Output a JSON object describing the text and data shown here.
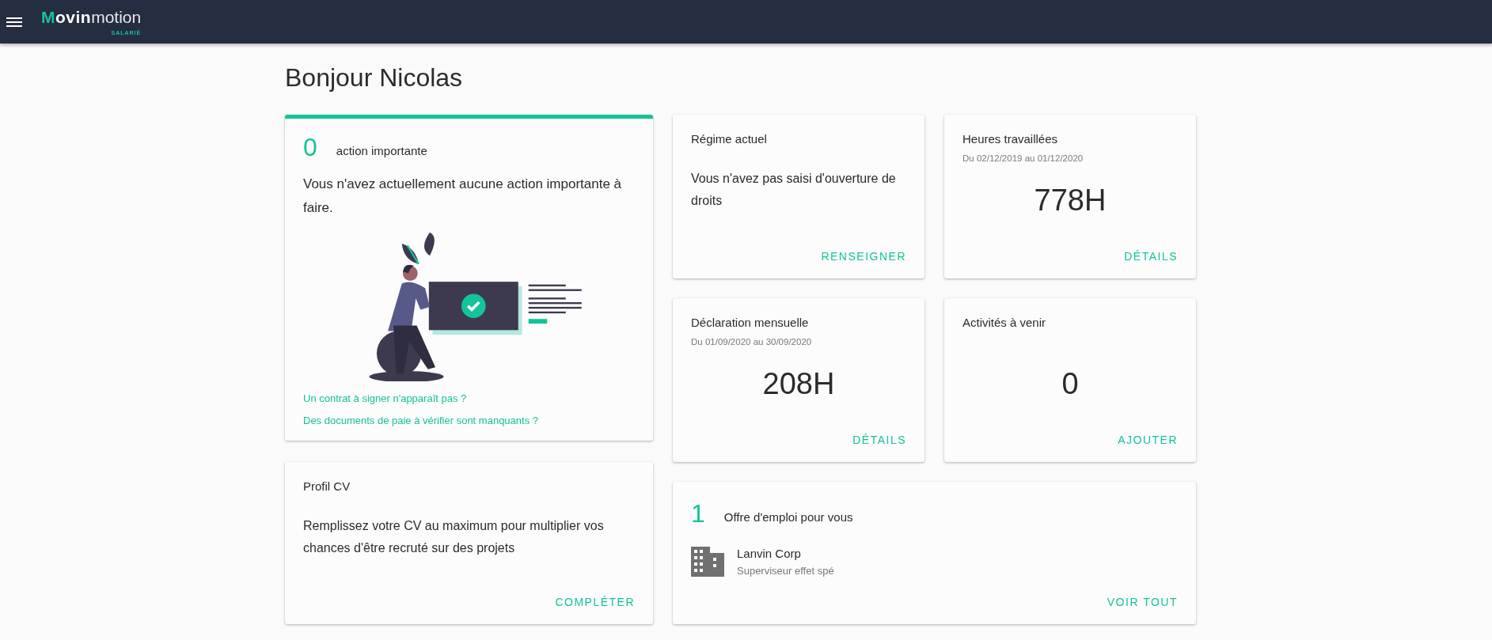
{
  "header": {
    "logo": {
      "bold": "Movin",
      "light": "motion",
      "tagline": "SALARIÉ"
    }
  },
  "greeting": "Bonjour Nicolas",
  "actions_card": {
    "count": "0",
    "label": "action importante",
    "message": "Vous n'avez actuellement aucune action importante à faire.",
    "links": [
      "Un contrat à signer n'apparaît pas ?",
      "Des documents de paie à vérifier sont manquants ?"
    ]
  },
  "profile_card": {
    "title": "Profil CV",
    "message": "Remplissez votre CV au maximum pour multiplier vos chances d'être recruté sur des projets",
    "action": "COMPLÉTER"
  },
  "tiles": [
    {
      "kind": "text",
      "title": "Régime actuel",
      "message": "Vous n'avez pas saisi d'ouverture de droits",
      "action": "RENSEIGNER"
    },
    {
      "kind": "value",
      "title": "Heures travaillées",
      "period": "Du 02/12/2019 au 01/12/2020",
      "value": "778H",
      "action": "DÉTAILS"
    },
    {
      "kind": "value",
      "title": "Déclaration mensuelle",
      "period": "Du 01/09/2020 au 30/09/2020",
      "value": "208H",
      "action": "DÉTAILS"
    },
    {
      "kind": "value",
      "title": "Activités à venir",
      "value": "0",
      "action": "AJOUTER"
    }
  ],
  "jobs_card": {
    "count": "1",
    "label": "Offre d'emploi pour vous",
    "offers": [
      {
        "company": "Lanvin Corp",
        "position": "Superviseur effet spé"
      }
    ],
    "action": "VOIR TOUT"
  }
}
